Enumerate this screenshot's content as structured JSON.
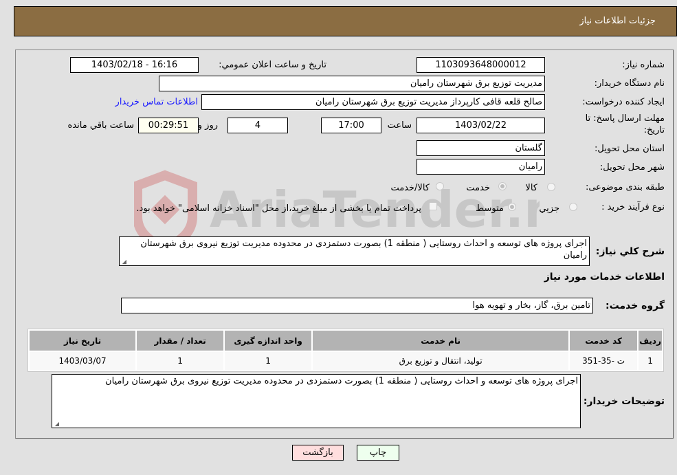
{
  "header": {
    "title": "جزئیات اطلاعات نیاز"
  },
  "form": {
    "need_number": {
      "label": "شماره نیاز:",
      "value": "1103093648000012"
    },
    "announce": {
      "label": "تاریخ و ساعت اعلان عمومي:",
      "value": "1403/02/18 - 16:16"
    },
    "buyer_org": {
      "label": "نام دستگاه خریدار:",
      "value": "مدیریت توزیع برق شهرستان رامیان"
    },
    "creator": {
      "label": "ایجاد کننده درخواست:",
      "value": "صالح قلعه قافی کارپرداز مدیریت توزیع برق شهرستان رامیان",
      "contact_link": "اطلاعات تماس خریدار"
    },
    "deadline": {
      "label_line1": "مهلت ارسال پاسخ: تا",
      "label_line2": "تاریخ:",
      "date": "1403/02/22",
      "time_label": "ساعت",
      "time": "17:00",
      "days": "4",
      "days_label": "روز و",
      "remaining": "00:29:51",
      "remaining_label": "ساعت باقي مانده"
    },
    "province": {
      "label": "استان محل تحویل:",
      "value": "گلستان"
    },
    "city": {
      "label": "شهر محل تحویل:",
      "value": "رامیان"
    },
    "category": {
      "label": "طبقه بندی موضوعی:",
      "options": [
        "کالا",
        "خدمت",
        "کالا/خدمت"
      ],
      "selected": "خدمت"
    },
    "purchase_type": {
      "label": "نوع فرآیند خرید :",
      "options": [
        "جزيي",
        "متوسط"
      ],
      "selected": "متوسط",
      "treasury_note": "پرداخت تمام یا بخشی از مبلغ خرید،از محل \"اسناد خزانه اسلامی\" خواهد بود."
    }
  },
  "description": {
    "label": "شرح کلي نیاز:",
    "value": "اجرای پروژه های توسعه و احداث روستایی ( منطقه 1) بصورت دستمزدی در محدوده مدیریت توزیع نیروی برق شهرستان رامیان"
  },
  "services_section": {
    "title": "اطلاعات خدمات مورد نیاز",
    "group_label": "گروه خدمت:",
    "group_value": "تامین برق، گاز، بخار و تهویه هوا"
  },
  "table": {
    "headers": [
      "ردیف",
      "کد خدمت",
      "نام خدمت",
      "واحد اندازه گیری",
      "تعداد / مقدار",
      "تاریخ نیاز"
    ],
    "rows": [
      [
        "1",
        "ت -35-351",
        "تولید، انتقال و توزیع برق",
        "1",
        "1",
        "1403/03/07"
      ]
    ]
  },
  "buyer_notes": {
    "label": "توضیحات خریدار:",
    "value": "اجرای پروژه های توسعه و احداث روستایی ( منطقه 1) بصورت دستمزدی در محدوده مدیریت توزیع نیروی برق شهرستان رامیان"
  },
  "buttons": {
    "print": "چاپ",
    "back": "بازگشت"
  },
  "watermark": {
    "text": "AriaTender.neT"
  },
  "colors": {
    "header_bg": "#8b6d42",
    "print_bg": "#eeffee",
    "back_bg": "#ffdede",
    "link": "#1a1aff"
  }
}
